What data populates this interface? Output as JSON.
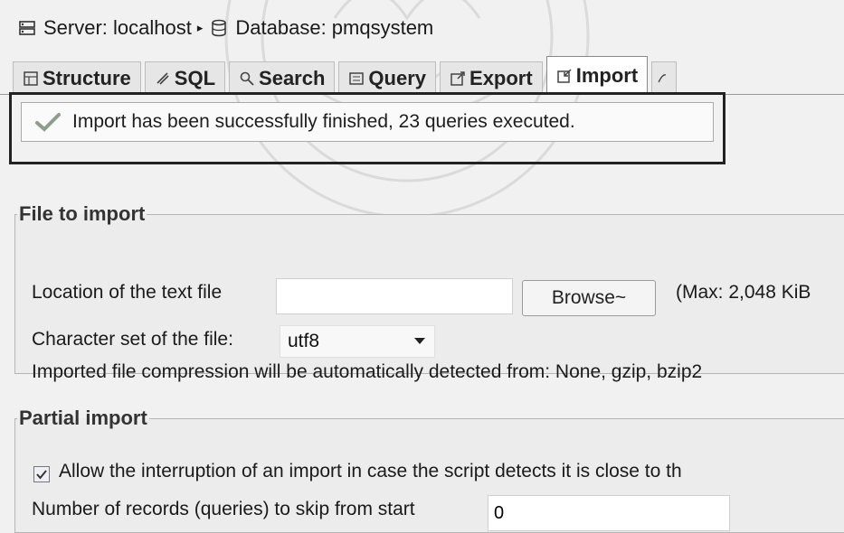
{
  "breadcrumb": {
    "server_label": "Server: localhost",
    "database_label": "Database: pmqsystem",
    "separator": "▸"
  },
  "tabs": [
    {
      "label": "Structure",
      "active": false
    },
    {
      "label": "SQL",
      "active": false
    },
    {
      "label": "Search",
      "active": false
    },
    {
      "label": "Query",
      "active": false
    },
    {
      "label": "Export",
      "active": false
    },
    {
      "label": "Import",
      "active": true
    }
  ],
  "notice": {
    "message": "Import has been successfully finished, 23 queries executed.",
    "icon": "check-icon"
  },
  "file_to_import": {
    "legend": "File to import",
    "location_label": "Location of the text file",
    "location_value": "",
    "browse_label": "Browse~",
    "max_size": "(Max: 2,048 KiB",
    "charset_label": "Character set of the file:",
    "charset_value": "utf8",
    "compression_note": "Imported file compression will be automatically detected from: None, gzip, bzip2"
  },
  "partial_import": {
    "legend": "Partial import",
    "allow_interrupt_label": "Allow the interruption of an import in case the script detects it is close to th",
    "allow_interrupt_checked": true,
    "skip_label": "Number of records (queries) to skip from start",
    "skip_value": "0"
  },
  "colors": {
    "background": "#f1f1f1",
    "notice_border": "#222222",
    "check": "#8aa08a"
  }
}
